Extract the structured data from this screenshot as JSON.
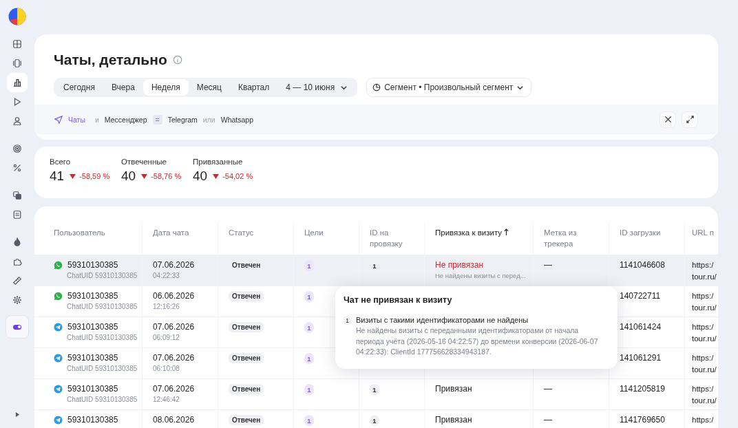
{
  "sidebar": {
    "groups": [
      {
        "items": [
          {
            "selected": false
          },
          {
            "selected": false
          },
          {
            "selected": true
          },
          {
            "selected": false
          },
          {
            "selected": false
          }
        ]
      },
      {
        "items": [
          {
            "selected": false
          },
          {
            "selected": false
          }
        ]
      },
      {
        "items": [
          {
            "selected": false
          },
          {
            "selected": false
          }
        ]
      },
      {
        "items": [
          {
            "selected": false
          },
          {
            "selected": false
          },
          {
            "selected": false
          },
          {
            "selected": false
          }
        ]
      }
    ],
    "toggle": {
      "on": true
    }
  },
  "header": {
    "title": "Чаты, детально",
    "periods": [
      {
        "label": "Сегодня",
        "selected": false
      },
      {
        "label": "Вчера",
        "selected": false
      },
      {
        "label": "Неделя",
        "selected": true
      },
      {
        "label": "Месяц",
        "selected": false
      },
      {
        "label": "Квартал",
        "selected": false
      }
    ],
    "date_range": "4 — 10 июня",
    "segment": "Сегмент • Произвольный сегмент",
    "filter": {
      "entity": "Чаты",
      "conjunction": "и",
      "field": "Мессенджер",
      "operator": "=",
      "values": [
        "Telegram",
        "Whatsapp"
      ],
      "separator": "или"
    }
  },
  "stats": [
    {
      "label": "Всего",
      "value": "41",
      "delta": "-58,59 %",
      "decrease": true
    },
    {
      "label": "Отвеченные",
      "value": "40",
      "delta": "-58,76 %",
      "decrease": true
    },
    {
      "label": "Привязанные",
      "value": "40",
      "delta": "-54,02 %",
      "decrease": true
    }
  ],
  "table": {
    "columns": [
      {
        "label": "Пользователь",
        "sorted": false
      },
      {
        "label": "Дата чата",
        "sorted": false
      },
      {
        "label": "Статус",
        "sorted": false
      },
      {
        "label": "Цели",
        "sorted": false
      },
      {
        "label": "ID на провязку",
        "sorted": false
      },
      {
        "label": "Привязка к визиту",
        "sorted": true
      },
      {
        "label": "Метка из трекера",
        "sorted": false
      },
      {
        "label": "ID загрузки",
        "sorted": false
      },
      {
        "label": "URL п",
        "sorted": false
      }
    ],
    "rows": [
      {
        "selected": true,
        "kind": "whatsapp",
        "user": "59310130385",
        "chat_uid": "ChatUID 59310130385",
        "date": "07.06.2026",
        "time": "04:22:33",
        "status": "Отвечен",
        "goals": "1",
        "bind_id": "1",
        "binding": {
          "text": "Не привязан",
          "linked": false,
          "note": "Не найдены визиты с перед..."
        },
        "marker": "—",
        "upload_id": "1141046608",
        "url": [
          "https:/",
          "tour.ru/"
        ]
      },
      {
        "selected": false,
        "kind": "whatsapp",
        "user": "59310130385",
        "chat_uid": "ChatUID 59310130385",
        "date": "06.06.2026",
        "time": "12:16:26",
        "status": "Отвечен",
        "goals": "1",
        "upload_id": "140722711",
        "url": [
          "https:/",
          "tour.ru/"
        ]
      },
      {
        "selected": false,
        "user": "59310130385",
        "chat_uid": "ChatUID 59310130385",
        "date": "07.06.2026",
        "time": "06:09:12",
        "kind": "telegram",
        "status": "Отвечен",
        "goals": "1",
        "upload_id": "141061424",
        "url": [
          "https:/",
          "tour.ru/"
        ]
      },
      {
        "selected": false,
        "kind": "telegram",
        "user": "59310130385",
        "chat_uid": "ChatUID 59310130385",
        "date": "07.06.2026",
        "time": "06:10:08",
        "status": "Отвечен",
        "goals": "1",
        "upload_id": "141061291",
        "url": [
          "https:/",
          "tour.ru/"
        ]
      },
      {
        "selected": false,
        "kind": "telegram",
        "user": "59310130385",
        "chat_uid": "ChatUID 59310130385",
        "date": "07.06.2026",
        "time": "12:46:42",
        "status": "Отвечен",
        "goals": "1",
        "bind_id": "1",
        "binding": {
          "text": "Привязан",
          "linked": true
        },
        "marker": "—",
        "upload_id": "1141205819",
        "url": [
          "https:/",
          "tour.ru/"
        ]
      },
      {
        "selected": false,
        "kind": "telegram",
        "user": "59310130385",
        "date": "08.06.2026",
        "status": "Отвечен",
        "goals": "1",
        "bind_id": "1",
        "binding": {
          "text": "Привязан",
          "linked": true
        },
        "marker": "—",
        "upload_id": "1141769650",
        "url": [
          "https:/"
        ]
      }
    ]
  },
  "tooltip": {
    "title": "Чат не привязан к визиту",
    "items": [
      {
        "number": "1",
        "title": "Визиты с такими идентификаторами не найдены",
        "text": "Не найдены визиты с переданными идентификаторами от начала периода учёта (2026-05-16 04:22:57) до времени конверсии (2026-06-07 04:22:33): ClientId 177756628334943187."
      }
    ]
  }
}
